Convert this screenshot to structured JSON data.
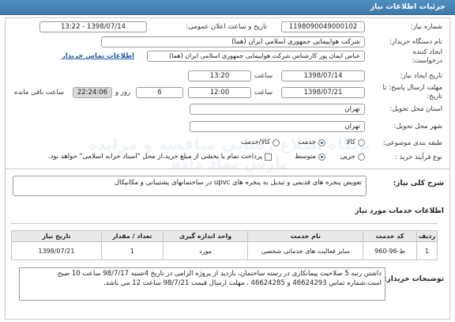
{
  "header": {
    "title": "جزئیات اطلاعات نیاز"
  },
  "fields": {
    "need_number": {
      "label": "شماره نیاز:",
      "value": "1198090049000102"
    },
    "announce_datetime": {
      "label": "تاریخ و ساعت اعلان عمومی:",
      "value": "1398/07/14 - 13:22"
    },
    "buyer_org": {
      "label": "نام دستگاه خریدار:",
      "value": "شرکت هواپیمایی جمهوری اسلامی ایران (هما)"
    },
    "requester": {
      "label_line1": "ایجاد کننده",
      "label_line2": "درخواست:",
      "value": "عباس ایمان پور کارشناس شرکت هواپیمایی جمهوری اسلامی ایران (هما)",
      "contact_link": "اطلاعات تماس خریدار"
    },
    "creation_date": {
      "label": "تاریخ ایجاد نیاز:",
      "date": "1398/07/14",
      "time_label": "ساعت",
      "time": "13:20"
    },
    "deadline": {
      "label_line1": "مهلت ارسال پاسخ: تا",
      "label_line2": "تاریخ:",
      "date": "1398/07/21",
      "time_label": "ساعت",
      "time": "12:00",
      "days": "6",
      "days_label": "روز و",
      "remaining_time": "22:24:06",
      "remaining_label": "ساعت باقی مانده"
    },
    "province": {
      "label": "استان محل تحویل:",
      "value": "تهران"
    },
    "city": {
      "label": "شهر محل تحویل:",
      "value": "تهران"
    },
    "category": {
      "label": "طبقه بندی موضوعی:",
      "options": [
        "کالا",
        "خدمت",
        "کالا/خدمت"
      ],
      "selected": "خدمت"
    },
    "purchase_type": {
      "label": "نوع فرآیند خرید :",
      "options": [
        "جزیی",
        "متوسط"
      ],
      "selected": "متوسط",
      "payment_note": "پرداخت تمام یا بخشی از مبلغ خرید،از محل \"اسناد خزانه اسلامی\" خواهد بود."
    }
  },
  "summary": {
    "label": "شرح کلی نیاز:",
    "value": "تعویض پنجره های قدیمی و تبدیل به پنجره های upvc در ساختمانهای پشتیبانی و مکانیکال"
  },
  "services": {
    "title": "اطلاعات خدمات مورد نیاز",
    "columns": [
      "ردیف",
      "کد خدمت",
      "نام خدمت",
      "واحد اندازه گیری",
      "تعداد / مقدار",
      "تاریخ نیاز"
    ],
    "rows": [
      {
        "row": "1",
        "code": "ط-96-960",
        "name": "سایر فعالیت های خدماتی شخصی",
        "unit": "مورد",
        "qty": "1",
        "date": "1398/07/21"
      }
    ]
  },
  "buyer_notes": {
    "label": "توضیحات خریدار:",
    "text": "داشتن رتبه 5 صلاحیت پیمانکاری در رسته ساختمان، بازدید از پروژه الزامی در تاریخ 4شنبه 98/7/17 ساعت 10 صبح است،شماره تماس 46624293 و 46624285 ، مهلت ارسال قیمت 98/7/21 ساعت 12 می باشد."
  },
  "watermark": {
    "line1": "پایگاه اطلاع رسانی مناقصه و مزایده",
    "line2": "پارس نماد داده"
  }
}
